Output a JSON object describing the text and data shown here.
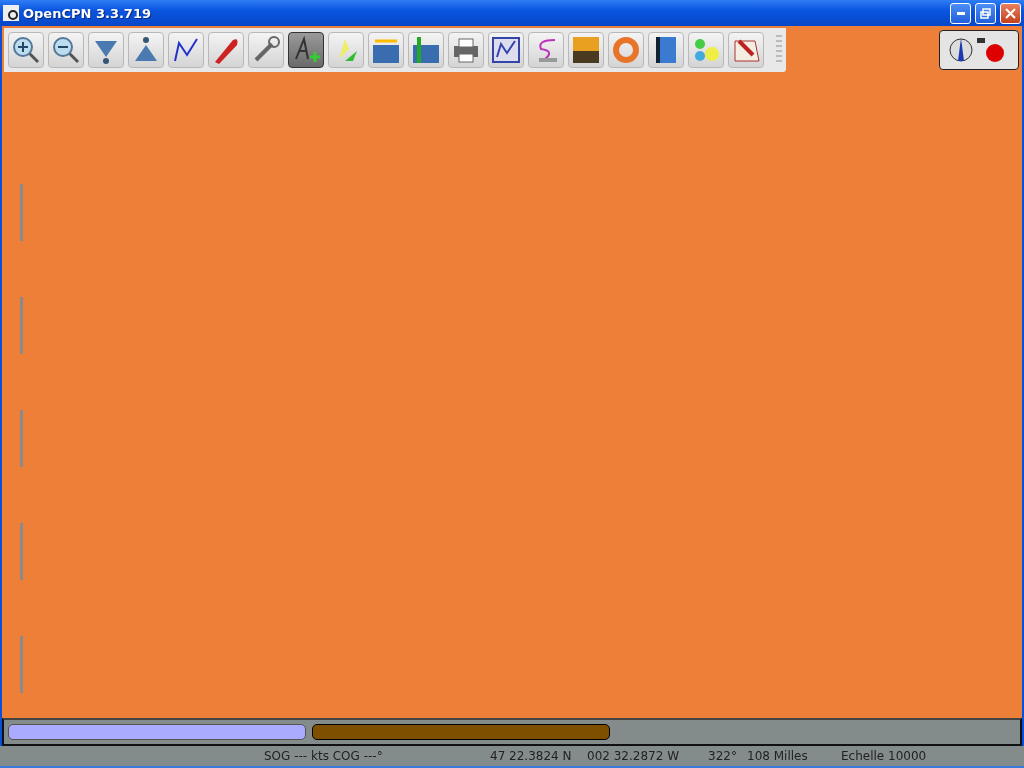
{
  "window": {
    "title": "OpenCPN 3.3.719"
  },
  "toolbar": [
    {
      "kind": "zoom-in",
      "selected": false
    },
    {
      "kind": "zoom-out",
      "selected": false
    },
    {
      "kind": "scale-down",
      "selected": false
    },
    {
      "kind": "scale-up",
      "selected": false
    },
    {
      "kind": "route",
      "selected": false
    },
    {
      "kind": "ship",
      "selected": false
    },
    {
      "kind": "settings",
      "selected": false
    },
    {
      "kind": "text",
      "selected": true
    },
    {
      "kind": "tracks",
      "selected": false
    },
    {
      "kind": "tide",
      "selected": false
    },
    {
      "kind": "current",
      "selected": false
    },
    {
      "kind": "print",
      "selected": false
    },
    {
      "kind": "route-manager",
      "selected": false
    },
    {
      "kind": "track",
      "selected": false
    },
    {
      "kind": "color-scheme",
      "selected": false
    },
    {
      "kind": "mob",
      "selected": false
    },
    {
      "kind": "help",
      "selected": false
    },
    {
      "kind": "dashboard",
      "selected": false
    },
    {
      "kind": "plugin",
      "selected": false
    }
  ],
  "chart_bar": [
    {
      "color": "#aaaaff",
      "selected": false
    },
    {
      "color": "#7f4f00",
      "selected": true
    }
  ],
  "status_bar": [
    "SOG --- kts COG ---°",
    "47 22.3824 N",
    "002 32.2872 W",
    "322°",
    "108 Milles",
    "Echelle 10000"
  ]
}
